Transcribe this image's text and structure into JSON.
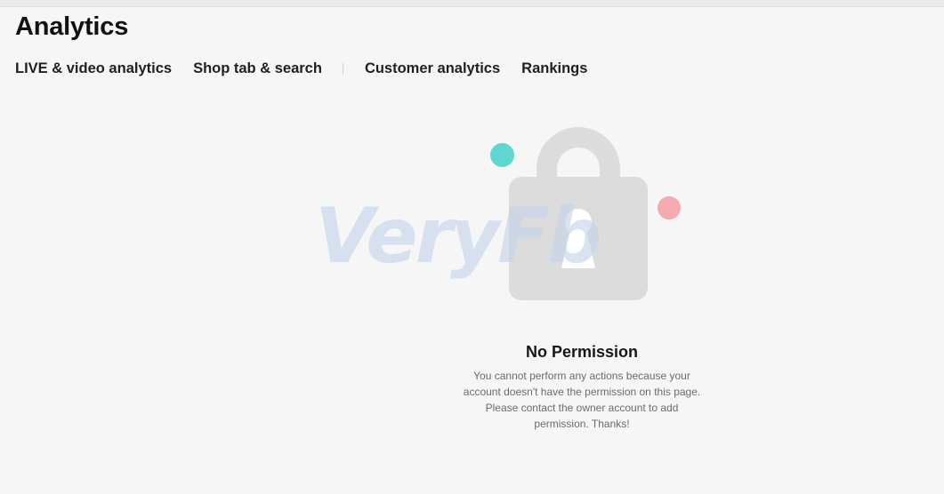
{
  "header": {
    "title": "Analytics"
  },
  "tabs": [
    {
      "label": "LIVE & video analytics"
    },
    {
      "label": "Shop tab & search"
    },
    {
      "label": "Customer analytics"
    },
    {
      "label": "Rankings"
    }
  ],
  "empty_state": {
    "icon": "lock-icon",
    "watermark": "VeryFb",
    "title": "No Permission",
    "description": "You cannot perform any actions because your account doesn't have the permission on this page. Please contact the owner account to add permission. Thanks!"
  },
  "colors": {
    "background": "#f6f6f6",
    "lock": "#dcdcdc",
    "accent_teal": "#5fd6d2",
    "accent_pink": "#f6aab0"
  }
}
